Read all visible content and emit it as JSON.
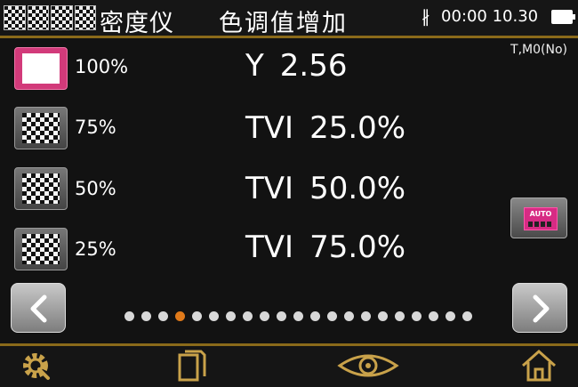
{
  "header": {
    "app_title": "密度仪",
    "screen_title": "色调值增加",
    "bluetooth_icon": "bluetooth-icon",
    "time": "00:00 10.30",
    "battery_icon": "battery-icon"
  },
  "mode_label": "T,M0(No)",
  "patches": [
    {
      "percent": "100%",
      "label": "Y",
      "value": "2.56",
      "active": true
    },
    {
      "percent": "75%",
      "label": "TVI",
      "value": "25.0%",
      "active": false
    },
    {
      "percent": "50%",
      "label": "TVI",
      "value": "50.0%",
      "active": false
    },
    {
      "percent": "25%",
      "label": "TVI",
      "value": "75.0%",
      "active": false
    }
  ],
  "auto_button": {
    "label": "AUTO"
  },
  "pagination": {
    "total_pages": 21,
    "current_page": 4
  },
  "nav": {
    "prev_icon": "chevron-left-icon",
    "next_icon": "chevron-right-icon"
  },
  "bottom_bar": {
    "settings_icon": "gear-icon",
    "files_icon": "documents-icon",
    "view_icon": "eye-icon",
    "home_icon": "home-icon"
  },
  "colors": {
    "accent_gold": "#8a6a1a",
    "active_patch": "#d23a7a",
    "active_dot": "#e07a1a",
    "icon_gold": "#c9a24a"
  }
}
